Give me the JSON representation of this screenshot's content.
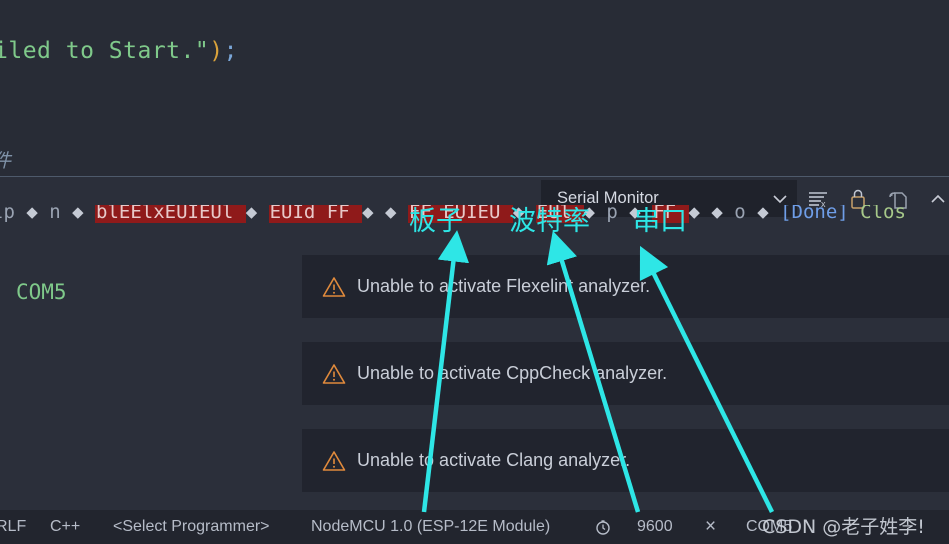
{
  "editor": {
    "code_green_a": "iled to Start.",
    "code_quote": "\"",
    "code_paren": ")",
    "code_semi": ";",
    "comment_fragment": "件"
  },
  "serial_toolbar": {
    "title": "Serial Monitor",
    "caret_icon": "chevron-down-icon",
    "buttons": [
      {
        "icon": "clear-output-icon",
        "label": "Clear Output"
      },
      {
        "icon": "lock-icon",
        "label": "Scroll Lock"
      },
      {
        "icon": "save-output-icon",
        "label": "Save Output"
      },
      {
        "icon": "chevron-up-icon",
        "label": "Collapse Panel"
      }
    ]
  },
  "serial_output": {
    "port_label": "COM5",
    "garbled_segments": [
      {
        "text": "lp",
        "style": "txt"
      },
      {
        "text": "◆",
        "style": "dia"
      },
      {
        "text": "n",
        "style": "txt"
      },
      {
        "text": "◆",
        "style": "dia"
      },
      {
        "text": "blEElxEUIEUl",
        "style": "red"
      },
      {
        "text": "◆",
        "style": "dia"
      },
      {
        "text": "EUId FF",
        "style": "red"
      },
      {
        "text": "◆",
        "style": "dia"
      },
      {
        "text": "◆",
        "style": "dia"
      },
      {
        "text": "FF EUIEU",
        "style": "red"
      },
      {
        "text": "◆",
        "style": "dia"
      },
      {
        "text": "EUl",
        "style": "red"
      },
      {
        "text": "◆",
        "style": "dia"
      },
      {
        "text": "p",
        "style": "txt"
      },
      {
        "text": "◆",
        "style": "dia"
      },
      {
        "text": "FF",
        "style": "red"
      },
      {
        "text": "◆",
        "style": "dia"
      },
      {
        "text": "◆",
        "style": "dia"
      },
      {
        "text": "o",
        "style": "txt"
      },
      {
        "text": "◆",
        "style": "dia"
      },
      {
        "text": "[Done]",
        "style": "done"
      },
      {
        "text": " Clos",
        "style": "clos"
      }
    ]
  },
  "notifications": [
    {
      "icon": "warning-triangle-icon",
      "message": "Unable to activate Flexelint analyzer."
    },
    {
      "icon": "warning-triangle-icon",
      "message": "Unable to activate CppCheck analyzer."
    },
    {
      "icon": "warning-triangle-icon",
      "message": "Unable to activate Clang analyzer."
    }
  ],
  "statusbar": {
    "line_ending": "RLF",
    "language": "C++",
    "programmer": "<Select Programmer>",
    "board": "NodeMCU 1.0 (ESP-12E Module)",
    "clock_icon": "clock-icon",
    "baud_rate": "9600",
    "disconnect_icon": "×",
    "port": "COM5"
  },
  "watermark": {
    "text": "CSDN @老子姓李!"
  },
  "annotations": [
    {
      "text": "板子",
      "meaning": "board"
    },
    {
      "text": "波特率",
      "meaning": "baud rate"
    },
    {
      "text": "串口",
      "meaning": "serial port"
    }
  ],
  "colors": {
    "background": "#2b2f3a",
    "editor_bg": "#282c36",
    "panel_bg": "#21242e",
    "statusbar_bg": "#22252e",
    "annotation": "#2ee6e6",
    "warning": "#e08a3c",
    "string_green": "#7fc98a",
    "garbled_red": "#8f1a1a"
  }
}
